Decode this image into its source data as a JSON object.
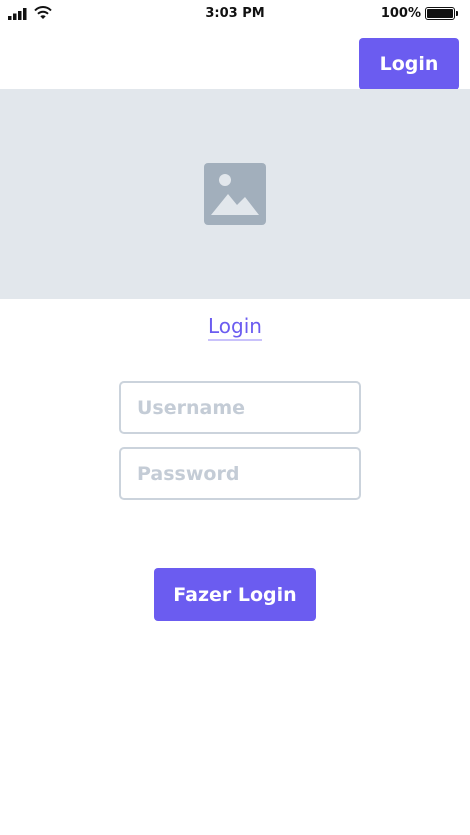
{
  "status_bar": {
    "time": "3:03 PM",
    "battery_percent": "100%",
    "battery_level": 1.0
  },
  "header": {
    "login_button_label": "Login"
  },
  "hero": {
    "icon": "image-placeholder-icon"
  },
  "form": {
    "title": "Login",
    "username_placeholder": "Username",
    "password_placeholder": "Password",
    "submit_label": "Fazer Login"
  },
  "colors": {
    "accent": "#6b5cf0",
    "hero_background": "#e2e7ec",
    "input_border": "#cbd3dc",
    "placeholder_icon": "#a2afbc"
  }
}
